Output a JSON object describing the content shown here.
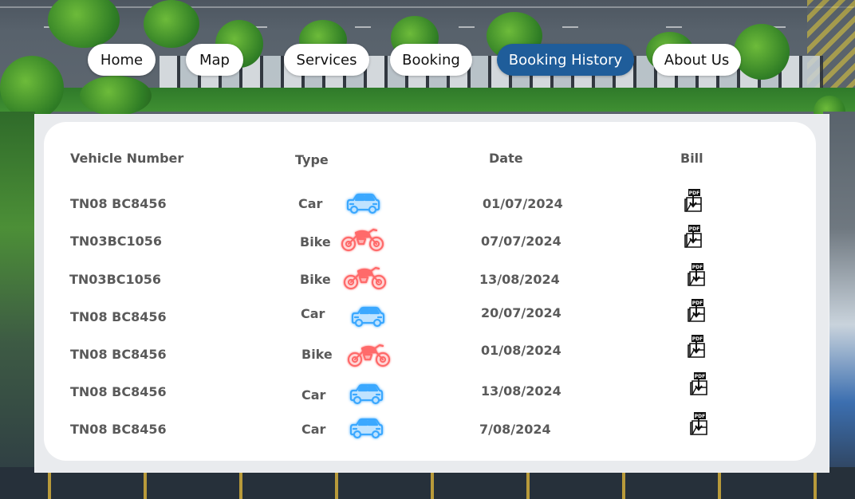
{
  "nav": {
    "items": [
      {
        "label": "Home",
        "active": false
      },
      {
        "label": "Map",
        "active": false
      },
      {
        "label": "Services",
        "active": false
      },
      {
        "label": "Booking",
        "active": false
      },
      {
        "label": "Booking History",
        "active": true
      },
      {
        "label": "About Us",
        "active": false
      }
    ],
    "active_color": "#1f5d9a"
  },
  "table": {
    "headers": {
      "vehicle": "Vehicle Number",
      "type": "Type",
      "date": "Date",
      "bill": "Bill"
    },
    "rows": [
      {
        "vehicle": "TN08 BC8456",
        "type": "Car",
        "icon": "car-icon",
        "date": "01/07/2024",
        "bill_icon": "pdf-download-icon"
      },
      {
        "vehicle": "TN03BC1056",
        "type": "Bike",
        "icon": "bike-icon",
        "date": "07/07/2024",
        "bill_icon": "pdf-download-icon"
      },
      {
        "vehicle": "TN03BC1056",
        "type": "Bike",
        "icon": "bike-icon",
        "date": "13/08/2024",
        "bill_icon": "pdf-download-icon"
      },
      {
        "vehicle": "TN08 BC8456",
        "type": "Car",
        "icon": "car-icon",
        "date": "20/07/2024",
        "bill_icon": "pdf-download-icon"
      },
      {
        "vehicle": "TN08 BC8456",
        "type": "Bike",
        "icon": "bike-icon",
        "date": "01/08/2024",
        "bill_icon": "pdf-download-icon"
      },
      {
        "vehicle": "TN08 BC8456",
        "type": "Car",
        "icon": "car-icon",
        "date": "13/08/2024",
        "bill_icon": "pdf-download-icon"
      },
      {
        "vehicle": "TN08 BC8456",
        "type": "Car",
        "icon": "car-icon",
        "date": "7/08/2024",
        "bill_icon": "pdf-download-icon"
      }
    ]
  },
  "colors": {
    "car_icon": "#3aa8ff",
    "bike_icon": "#ff6b6b"
  },
  "pdf_label": "PDF"
}
